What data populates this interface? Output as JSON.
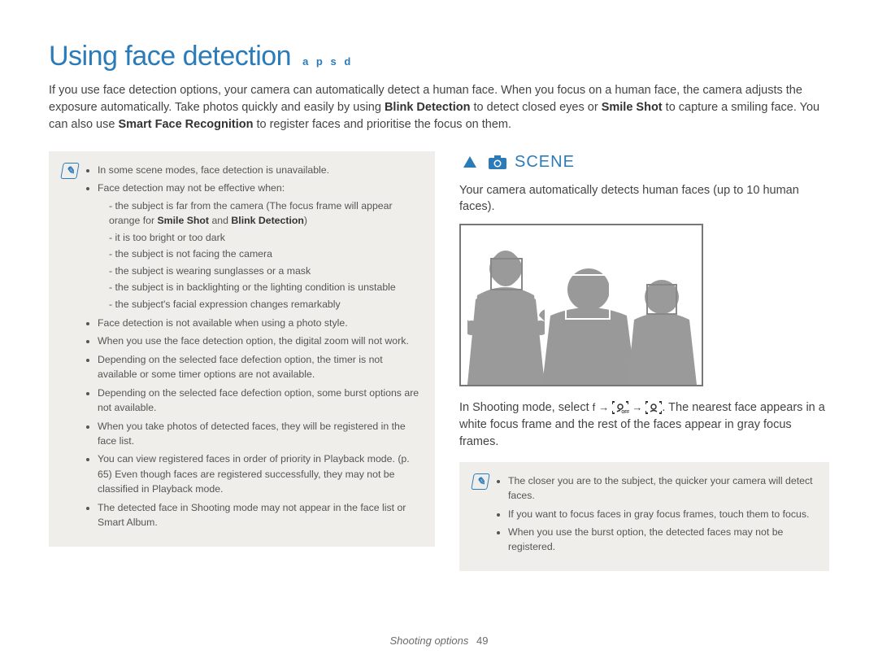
{
  "title": "Using face detection",
  "mode_letters": "a p s d",
  "intro_parts": {
    "t1": "If you use face detection options, your camera can automatically detect a human face. When you focus on a human face, the camera adjusts the exposure automatically. Take photos quickly and easily by using ",
    "b1": "Blink Detection",
    "t2": " to detect closed eyes or ",
    "b2": "Smile Shot",
    "t3": " to capture a smiling face. You can also use ",
    "b3": "Smart Face Recognition",
    "t4": " to register faces and prioritise the focus on them."
  },
  "left_notes": {
    "items": [
      "In some scene modes, face detection is unavailable.",
      "Face detection may not be effective when:",
      "Face detection is not available when using a photo style.",
      "When you use the face detection option, the digital zoom will not work.",
      "Depending on the selected face defection option, the timer is not available or some timer options are not available.",
      "Depending on the selected face defection option, some burst options are not available.",
      "When you take photos of detected faces, they will be registered in the face list.",
      "You can view registered faces in order of priority in Playback mode. (p. 65) Even though faces are registered successfully, they may not be classified in Playback mode.",
      "The detected face in Shooting mode may not appear in the face list or Smart Album."
    ],
    "sub_items_parts": [
      {
        "t1": "the subject is far from the camera (The focus frame will appear orange for ",
        "b1": "Smile Shot",
        "t2": " and ",
        "b2": "Blink Detection",
        "t3": ")"
      },
      {
        "t1": "it is too bright or too dark"
      },
      {
        "t1": "the subject is not facing the camera"
      },
      {
        "t1": "the subject is wearing sunglasses or a mask"
      },
      {
        "t1": "the subject is in backlighting or the lighting condition is unstable"
      },
      {
        "t1": "the subject's facial expression changes remarkably"
      }
    ]
  },
  "right": {
    "scene_label": "SCENE",
    "intro": "Your camera automatically detects human faces (up to 10 human faces).",
    "step_parts": {
      "t1": "In Shooting mode, select ",
      "f": "f",
      "arrow": "→",
      "t2": ". The nearest face appears in a white focus frame and the rest of the faces appear in gray focus frames."
    },
    "note_items": [
      "The closer you are to the subject, the quicker your camera will detect faces.",
      "If you want to focus faces in gray focus frames, touch them to focus.",
      "When you use the burst option, the detected faces may not be registered."
    ]
  },
  "footer": {
    "section": "Shooting options",
    "page": "49"
  }
}
